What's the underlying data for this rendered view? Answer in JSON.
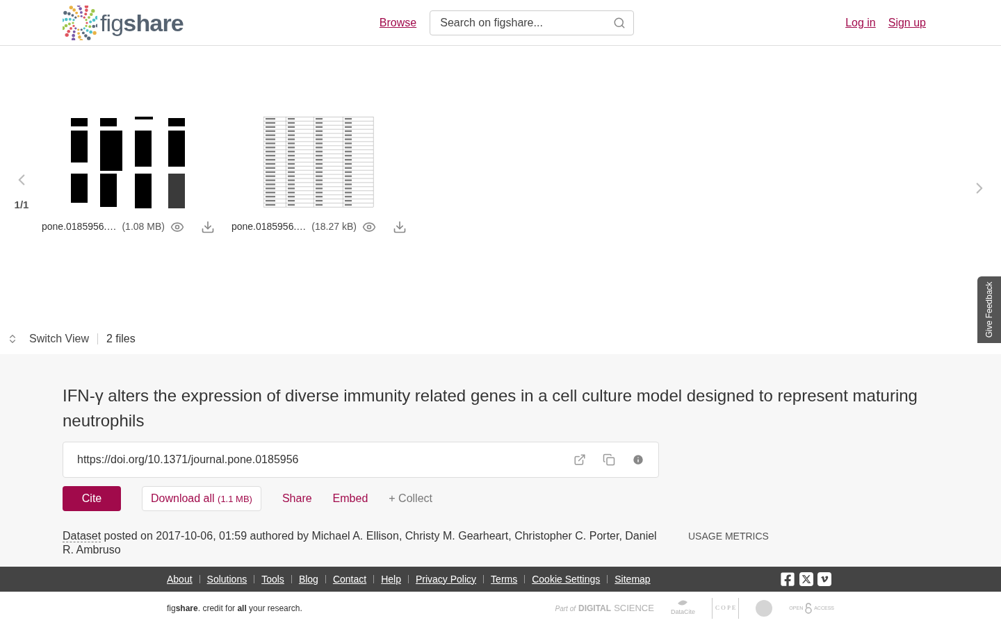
{
  "header": {
    "logo_text": "fig**share**",
    "browse": "Browse",
    "search": {
      "placeholder": "Search on figshare..."
    },
    "login": "Log in",
    "signup": "Sign up"
  },
  "viewer": {
    "counter": "1/1",
    "files": [
      {
        "kind": "blot",
        "name": "pone.0185956.…",
        "size": "(1.08 MB)"
      },
      {
        "kind": "table",
        "name": "pone.0185956.…",
        "size": "(18.27 kB)"
      }
    ],
    "feedback": "Give Feedback",
    "switch_view": "Switch View",
    "file_count": "2 files"
  },
  "item": {
    "title": "IFN-γ alters the expression of diverse immunity related genes in a cell culture model designed to represent maturing neutrophils",
    "doi": "https://doi.org/10.1371/journal.pone.0185956",
    "cite": "Cite",
    "download": "Download all",
    "download_size": "(1.1 MB)",
    "share": "Share",
    "embed": "Embed",
    "collect": "+ Collect",
    "type": "Dataset",
    "meta": " posted on 2017-10-06, 01:59 authored by Michael A. Ellison, Christy M. Gearheart, Christopher C. Porter, Daniel R. Ambruso",
    "usage": "USAGE METRICS"
  },
  "footer": {
    "links": [
      "About",
      "Solutions",
      "Tools",
      "Blog",
      "Contact",
      "Help",
      "Privacy Policy",
      "Terms",
      "Cookie Settings",
      "Sitemap"
    ],
    "tagline": "fig**share**. credit for **all** your research.",
    "partners": [
      {
        "kind": "ds",
        "pre": "Part of",
        "main": "DIGITAL",
        "post": "SCIENCE"
      },
      {
        "kind": "datacite",
        "main": "DataCite"
      },
      {
        "kind": "cope",
        "main": "C O P E"
      },
      {
        "kind": "seal"
      },
      {
        "kind": "oa",
        "pre": "OPEN",
        "post": "ACCESS"
      }
    ]
  }
}
